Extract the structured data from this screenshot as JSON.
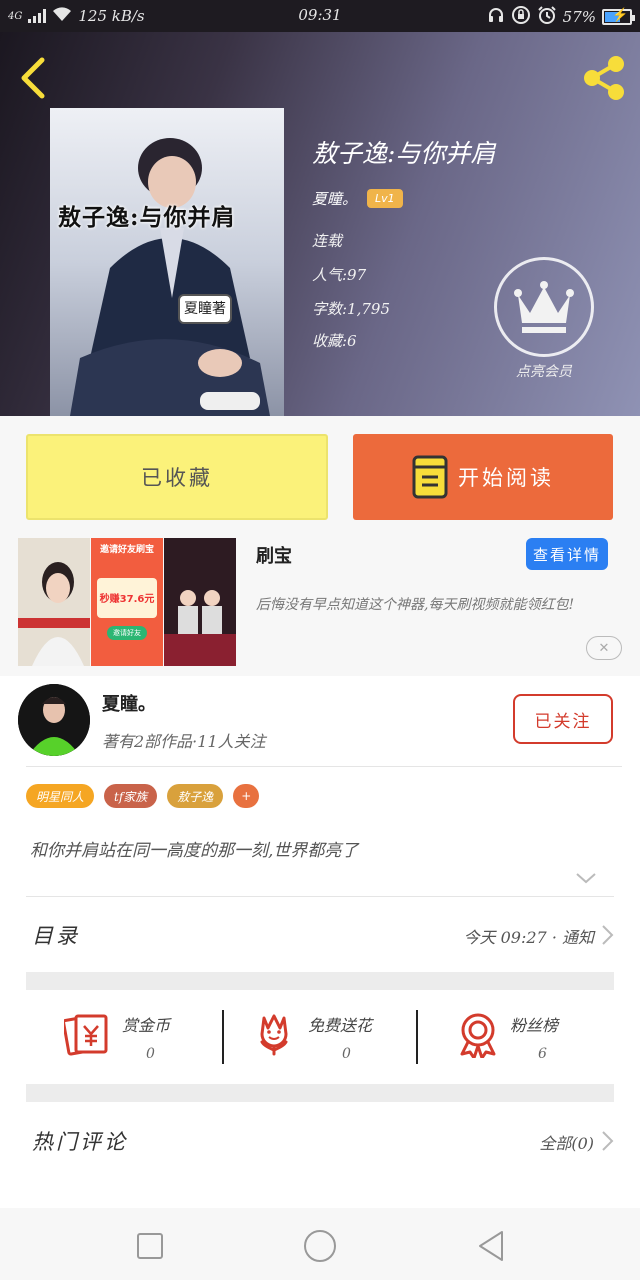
{
  "status_bar": {
    "network": "4G",
    "speed": "125 kB/s",
    "time": "09:31",
    "battery": "57%",
    "battery_level": 0.57
  },
  "book": {
    "title": "敖子逸:与你并肩",
    "author": "夏瞳。",
    "level": "Lv1",
    "status": "连载",
    "popularity": "人气:97",
    "word_count": "字数:1,795",
    "favorites": "收藏:6"
  },
  "cover": {
    "title_text": "敖子逸:与你并肩",
    "author_tag": "夏瞳著"
  },
  "vip": {
    "label": "点亮会员"
  },
  "actions": {
    "favorited_label": "已收藏",
    "read_label": "开始阅读"
  },
  "ad": {
    "title": "刷宝",
    "detail_label": "查看详情",
    "description": "后悔没有早点知道这个神器,每天刷视频就能领红包!",
    "img1_caption": "邀请好友刷宝",
    "img1_amount": "秒赚37.6元",
    "img1_button": "邀请好友",
    "close_icon": "✕"
  },
  "author_card": {
    "name": "夏瞳。",
    "subtitle": "著有2部作品·11人关注",
    "follow_label": "已关注"
  },
  "tags": [
    {
      "label": "明星同人",
      "color": "#f5a623"
    },
    {
      "label": "tf家族",
      "color": "#c9634a"
    },
    {
      "label": "敖子逸",
      "color": "#d9a13c"
    },
    {
      "label": "+",
      "color": "#e8713f"
    }
  ],
  "description": "和你并肩站在同一高度的那一刻,世界都亮了",
  "toc": {
    "label": "目录",
    "update": "今天 09:27 · 通知"
  },
  "stats": [
    {
      "name": "赏金币",
      "value": "0",
      "icon": "reward-envelope-icon"
    },
    {
      "name": "免费送花",
      "value": "0",
      "icon": "flower-icon"
    },
    {
      "name": "粉丝榜",
      "value": "6",
      "icon": "medal-icon"
    }
  ],
  "comments": {
    "label": "热门评论",
    "all": "全部(0)"
  },
  "colors": {
    "accent_orange": "#ec6a3c",
    "favorite_yellow": "#fbf27a",
    "follow_red": "#d33b2c",
    "detail_blue": "#2b7ff2",
    "icon_yellow": "#f7dd3a"
  }
}
